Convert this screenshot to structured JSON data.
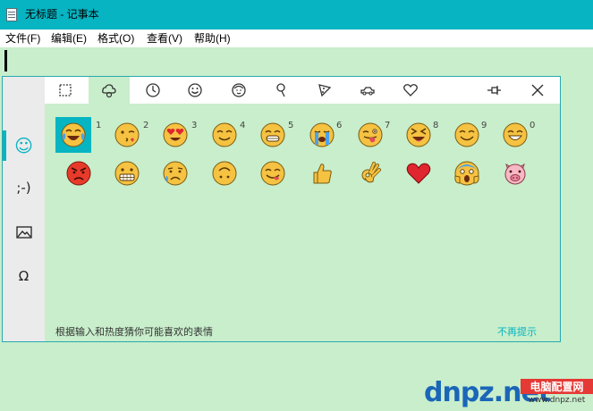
{
  "window": {
    "title": "无标题 - 记事本"
  },
  "menubar": {
    "items": [
      {
        "label": "文件(F)"
      },
      {
        "label": "编辑(E)"
      },
      {
        "label": "格式(O)"
      },
      {
        "label": "查看(V)"
      },
      {
        "label": "帮助(H)"
      }
    ]
  },
  "emoji_panel": {
    "side_tabs": [
      {
        "label": "☺",
        "name": "emoji"
      },
      {
        "label": ";-)",
        "name": "kaomoji"
      },
      {
        "label": "🖼",
        "name": "image"
      },
      {
        "label": "Ω",
        "name": "symbols"
      }
    ],
    "category_icons": [
      "square-icon",
      "smiley-cloud-icon",
      "clock-icon",
      "smiley-icon",
      "face-icon",
      "pin-icon",
      "pizza-icon",
      "car-icon",
      "heart-icon"
    ],
    "pin_icon": "pin-icon",
    "close_icon": "close-icon",
    "row1_numbers": [
      "1",
      "2",
      "3",
      "4",
      "5",
      "6",
      "7",
      "8",
      "9",
      "0"
    ],
    "row1": [
      "tears-of-joy",
      "winking-kiss",
      "heart-eyes",
      "blush",
      "grin",
      "crying",
      "tongue-wink",
      "squint-laugh",
      "smile",
      "grinning"
    ],
    "row2": [
      "angry",
      "grimace",
      "sad-sweat",
      "upside-down",
      "yum",
      "thumbs-up",
      "ok-hand",
      "red-heart",
      "scream",
      "pig"
    ],
    "hint": "根据输入和热度猜你可能喜欢的表情",
    "dismiss": "不再提示"
  },
  "watermark": {
    "text": "dnpz.net",
    "badge": "电脑配置网",
    "url": "www.dnpz.net"
  },
  "colors": {
    "accent": "#06b4c2",
    "background": "#c8eecb",
    "sidebar": "#ebebeb"
  }
}
